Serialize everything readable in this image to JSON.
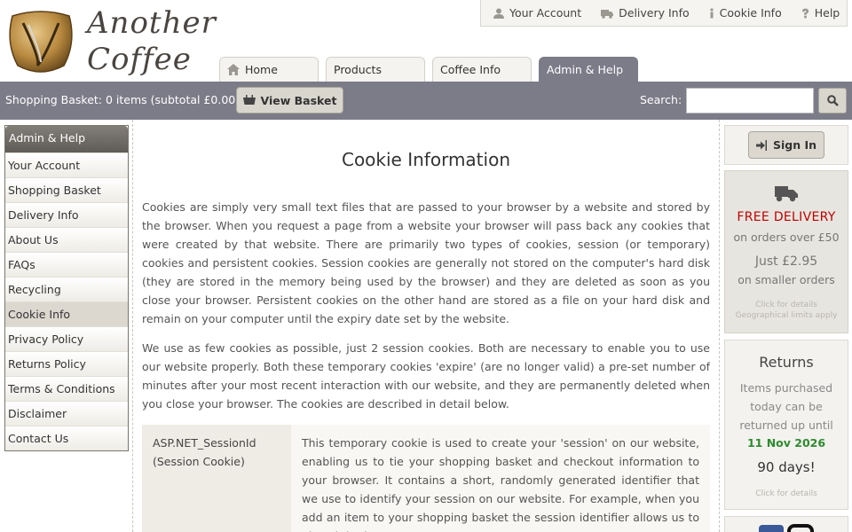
{
  "logo": {
    "line1": "Another",
    "line2": "Coffee"
  },
  "utility": [
    {
      "label": "Your Account",
      "icon": "user-icon"
    },
    {
      "label": "Delivery Info",
      "icon": "truck-icon"
    },
    {
      "label": "Cookie Info",
      "icon": "info-icon"
    },
    {
      "label": "Help",
      "icon": "question-icon"
    }
  ],
  "tabs": [
    {
      "label": "Home",
      "icon": "home-icon"
    },
    {
      "label": "Products"
    },
    {
      "label": "Coffee Info"
    },
    {
      "label": "Admin & Help",
      "active": true
    }
  ],
  "bar": {
    "basket_text": "Shopping Basket: 0 items (subtotal £0.00)",
    "view_basket": "View Basket",
    "search_label": "Search:",
    "search_value": ""
  },
  "leftnav": {
    "heading": "Admin & Help",
    "items": [
      "Your Account",
      "Shopping Basket",
      "Delivery Info",
      "About Us",
      "FAQs",
      "Recycling",
      "Cookie Info",
      "Privacy Policy",
      "Returns Policy",
      "Terms & Conditions",
      "Disclaimer",
      "Contact Us"
    ],
    "active_index": 6
  },
  "main": {
    "title": "Cookie Information",
    "para1": "Cookies are simply very small text files that are passed to your browser by a website and stored by the browser. When you request a page from a website your browser will pass back any cookies that were created by that website. There are primarily two types of cookies, session (or temporary) cookies and persistent cookies. Session cookies are generally not stored on the computer's hard disk (they are stored in the memory being used by the browser) and they are deleted as soon as you close your browser. Persistent cookies on the other hand are stored as a file on your hard disk and remain on your computer until the expiry date set by the website.",
    "para2": "We use as few cookies as possible, just 2 session cookies. Both are necessary to enable you to use our website properly. Both these temporary cookies 'expire' (are no longer valid) a pre-set number of minutes after your most recent interaction with our website, and they are permanently deleted when you close your browser. The cookies are described in detail below.",
    "cookie_name": "ASP.NET_SessionId",
    "cookie_type": "(Session Cookie)",
    "cookie_desc": "This temporary cookie is used to create your 'session' on our website, enabling us to tie your shopping basket and checkout information to your browser. It contains a short, randomly generated identifier that we use to identify your session on our website. For example, when you add an item to your shopping basket the session identifier allows us to place it in the"
  },
  "right": {
    "signin": "Sign In",
    "free_delivery": "FREE DELIVERY",
    "free_sub": "on orders over £50",
    "price": "Just £2.95",
    "price_sub": "on smaller orders",
    "click_details": "Click for details",
    "geo_limits": "Geographical limits apply",
    "returns_title": "Returns",
    "ret1": "Items purchased",
    "ret2": "today can be",
    "ret3": "returned up until",
    "ret_date": "11 Nov 2026",
    "ret_days": "90 days!",
    "ret_click": "Click for details"
  },
  "colors": {
    "bar": "#7c7b88",
    "free_delivery": "#c00000",
    "return_date": "#2e8b2e"
  }
}
